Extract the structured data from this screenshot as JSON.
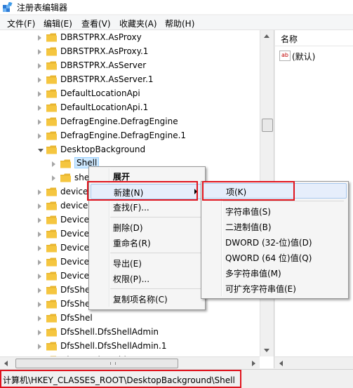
{
  "window": {
    "title": "注册表编辑器"
  },
  "menubar": [
    "文件(F)",
    "编辑(E)",
    "查看(V)",
    "收藏夹(A)",
    "帮助(H)"
  ],
  "tree": [
    {
      "label": "DBRSTPRX.AsProxy",
      "indent": 0,
      "state": "collapsed"
    },
    {
      "label": "DBRSTPRX.AsProxy.1",
      "indent": 0,
      "state": "collapsed"
    },
    {
      "label": "DBRSTPRX.AsServer",
      "indent": 0,
      "state": "collapsed"
    },
    {
      "label": "DBRSTPRX.AsServer.1",
      "indent": 0,
      "state": "collapsed"
    },
    {
      "label": "DefaultLocationApi",
      "indent": 0,
      "state": "collapsed"
    },
    {
      "label": "DefaultLocationApi.1",
      "indent": 0,
      "state": "collapsed"
    },
    {
      "label": "DefragEngine.DefragEngine",
      "indent": 0,
      "state": "collapsed"
    },
    {
      "label": "DefragEngine.DefragEngine.1",
      "indent": 0,
      "state": "collapsed"
    },
    {
      "label": "DesktopBackground",
      "indent": 0,
      "state": "expanded"
    },
    {
      "label": "Shell",
      "indent": 1,
      "state": "collapsed",
      "selected": true
    },
    {
      "label": "she",
      "indent": 1,
      "state": "collapsed"
    },
    {
      "label": "device",
      "indent": 0,
      "state": "collapsed"
    },
    {
      "label": "device.",
      "indent": 0,
      "state": "collapsed"
    },
    {
      "label": "Device",
      "indent": 0,
      "state": "collapsed"
    },
    {
      "label": "Device",
      "indent": 0,
      "state": "collapsed"
    },
    {
      "label": "Device",
      "indent": 0,
      "state": "collapsed"
    },
    {
      "label": "Device",
      "indent": 0,
      "state": "collapsed"
    },
    {
      "label": "Device",
      "indent": 0,
      "state": "collapsed"
    },
    {
      "label": "DfsShel",
      "indent": 0,
      "state": "collapsed"
    },
    {
      "label": "DfsShel",
      "indent": 0,
      "state": "collapsed"
    },
    {
      "label": "DfsShel",
      "indent": 0,
      "state": "collapsed"
    },
    {
      "label": "DfsShell.DfsShellAdmin",
      "indent": 0,
      "state": "collapsed"
    },
    {
      "label": "DfsShell.DfsShellAdmin.1",
      "indent": 0,
      "state": "collapsed"
    },
    {
      "label": "Diagnostic.Cabinet",
      "indent": 0,
      "state": "collapsed"
    }
  ],
  "values_pane": {
    "column_name": "名称",
    "rows": [
      {
        "name": "(默认)"
      }
    ]
  },
  "context_menu": {
    "items": [
      {
        "label": "展开",
        "bold": true
      },
      {
        "label": "新建(N)",
        "submenu": true,
        "highlighted": true
      },
      {
        "label": "查找(F)..."
      },
      {
        "sep": true
      },
      {
        "label": "删除(D)"
      },
      {
        "label": "重命名(R)"
      },
      {
        "sep": true
      },
      {
        "label": "导出(E)"
      },
      {
        "label": "权限(P)..."
      },
      {
        "sep": true
      },
      {
        "label": "复制项名称(C)"
      }
    ]
  },
  "submenu": {
    "items": [
      {
        "label": "项(K)",
        "highlighted": true
      },
      {
        "sep": true
      },
      {
        "label": "字符串值(S)"
      },
      {
        "label": "二进制值(B)"
      },
      {
        "label": "DWORD (32-位)值(D)"
      },
      {
        "label": "QWORD (64 位)值(Q)"
      },
      {
        "label": "多字符串值(M)"
      },
      {
        "label": "可扩充字符串值(E)"
      }
    ]
  },
  "status": {
    "path": "计算机\\HKEY_CLASSES_ROOT\\DesktopBackground\\Shell"
  },
  "colors": {
    "highlight_box": "#e0141e",
    "folder": "#f5c640",
    "selection": "#cde8ff"
  }
}
